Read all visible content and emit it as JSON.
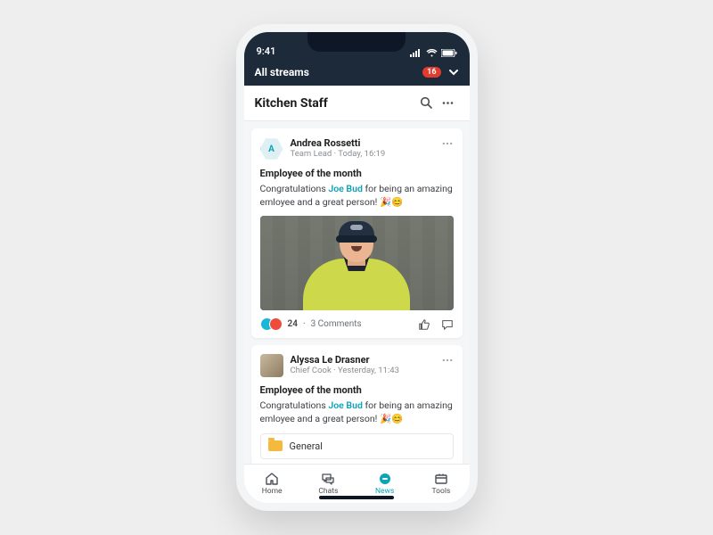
{
  "status": {
    "time": "9:41"
  },
  "streams": {
    "label": "All streams",
    "badge": "16"
  },
  "channel": {
    "title": "Kitchen Staff"
  },
  "posts": [
    {
      "avatar_initial": "A",
      "author": "Andrea Rossetti",
      "role": "Team Lead",
      "time": "Today, 16:19",
      "title": "Employee of the month",
      "body_pre": "Congratulations ",
      "mention": "Joe Bud",
      "body_post": " for being an amazing emloyee and a great person! 🎉😊",
      "reactions_count": "24",
      "comments": "3 Comments"
    },
    {
      "author": "Alyssa Le Drasner",
      "role": "Chief Cook",
      "time": "Yesterday, 11:43",
      "title": "Employee of the month",
      "body_pre": "Congratulations ",
      "mention": "Joe Bud",
      "body_post": " for being an amazing emloyee and a great person! 🎉😊",
      "attachment": "General"
    }
  ],
  "nav": {
    "home": "Home",
    "chats": "Chats",
    "news": "News",
    "tools": "Tools"
  }
}
